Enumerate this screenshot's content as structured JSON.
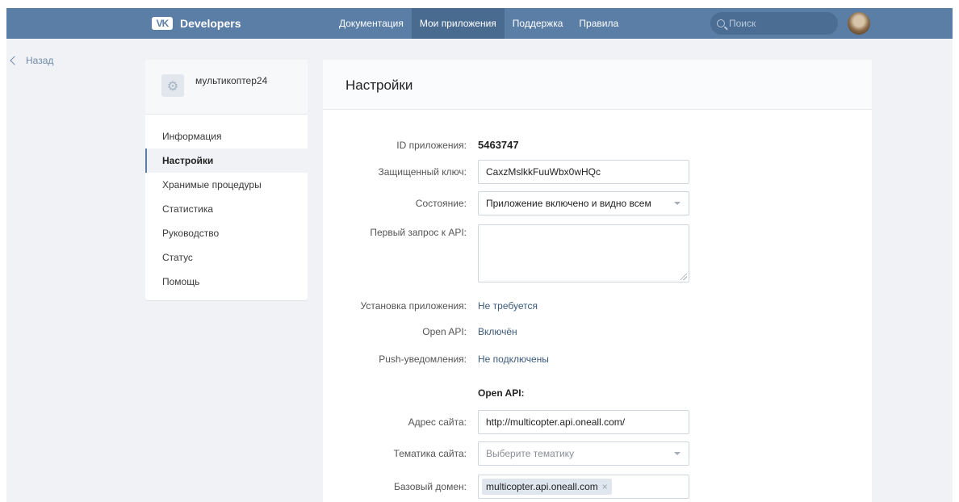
{
  "topbar": {
    "logo_mark": "VK",
    "logo_text": "Developers",
    "nav": [
      {
        "label": "Документация",
        "active": false
      },
      {
        "label": "Мои приложения",
        "active": true
      },
      {
        "label": "Поддержка",
        "active": false
      },
      {
        "label": "Правила",
        "active": false
      }
    ],
    "search_placeholder": "Поиск"
  },
  "back_label": "Назад",
  "sidebar": {
    "app_name": "мультикоптер24",
    "items": [
      {
        "label": "Информация",
        "active": false
      },
      {
        "label": "Настройки",
        "active": true
      },
      {
        "label": "Хранимые процедуры",
        "active": false
      },
      {
        "label": "Статистика",
        "active": false
      },
      {
        "label": "Руководство",
        "active": false
      },
      {
        "label": "Статус",
        "active": false
      },
      {
        "label": "Помощь",
        "active": false
      }
    ]
  },
  "main": {
    "title": "Настройки",
    "app_id_label": "ID приложения:",
    "app_id_value": "5463747",
    "secret_label": "Защищенный ключ:",
    "secret_value": "CaxzMslkkFuuWbx0wHQc",
    "state_label": "Состояние:",
    "state_value": "Приложение включено и видно всем",
    "first_request_label": "Первый запрос к API:",
    "first_request_value": "",
    "install_label": "Установка приложения:",
    "install_value": "Не требуется",
    "open_api_label": "Open API:",
    "open_api_value": "Включён",
    "push_label": "Push-уведомления:",
    "push_value": "Не подключены",
    "open_api_section_title": "Open API:",
    "site_address_label": "Адрес сайта:",
    "site_address_value": "http://multicopter.api.oneall.com/",
    "site_topic_label": "Тематика сайта:",
    "site_topic_placeholder": "Выберите тематику",
    "base_domain_label": "Базовый домен:",
    "base_domain_token": "multicopter.api.oneall.com",
    "token_remove": "×"
  }
}
